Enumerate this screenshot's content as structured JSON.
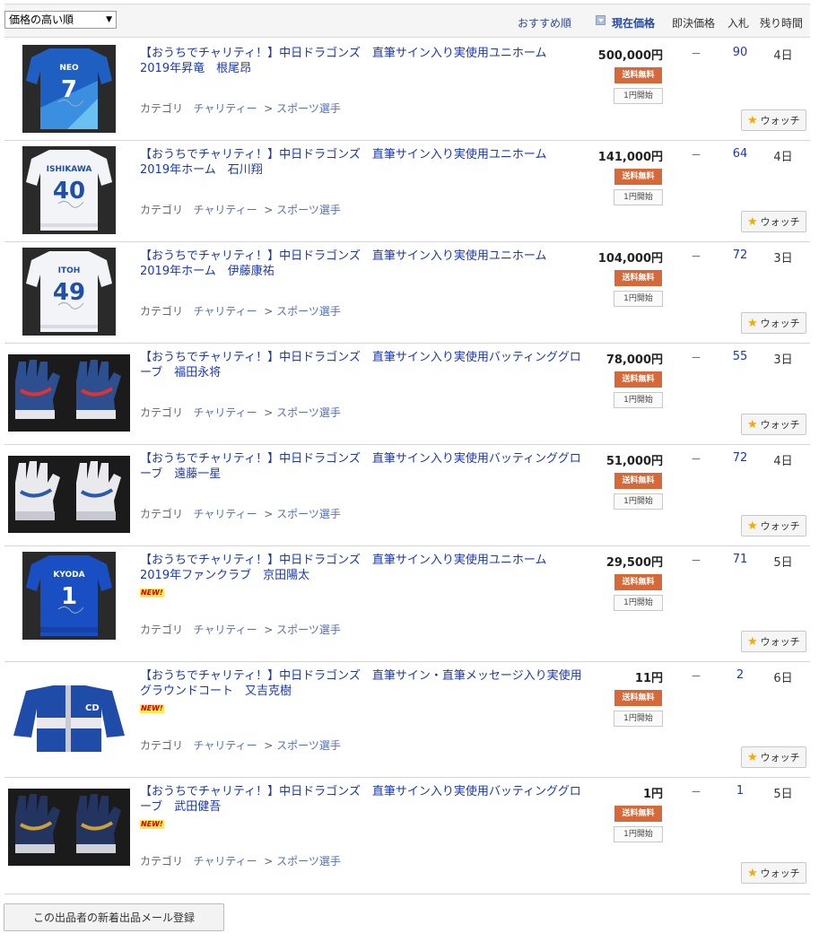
{
  "header": {
    "sort_selected": "価格の高い順",
    "recommended": "おすすめ順",
    "current_price": "現在価格",
    "buyout_price": "即決価格",
    "bids": "入札",
    "time_left": "残り時間"
  },
  "items": [
    {
      "title": "【おうちでチャリティ！】中日ドラゴンズ　直筆サイン入り実使用ユニホーム　2019年昇竜　根尾昂",
      "price": "500,000円",
      "shipping": "送料無料",
      "start": "1円開始",
      "buyout": "－",
      "bids": "90",
      "time_left": "4日",
      "category_label": "カテゴリ",
      "category1": "チャリティー",
      "category2": "スポーツ選手",
      "watch": "ウォッチ",
      "image": "jersey-blue-7",
      "new": ""
    },
    {
      "title": "【おうちでチャリティ！】中日ドラゴンズ　直筆サイン入り実使用ユニホーム　2019年ホーム　石川翔",
      "price": "141,000円",
      "shipping": "送料無料",
      "start": "1円開始",
      "buyout": "－",
      "bids": "64",
      "time_left": "4日",
      "category_label": "カテゴリ",
      "category1": "チャリティー",
      "category2": "スポーツ選手",
      "watch": "ウォッチ",
      "image": "jersey-white-40",
      "new": ""
    },
    {
      "title": "【おうちでチャリティ！】中日ドラゴンズ　直筆サイン入り実使用ユニホーム　2019年ホーム　伊藤康祐",
      "price": "104,000円",
      "shipping": "送料無料",
      "start": "1円開始",
      "buyout": "－",
      "bids": "72",
      "time_left": "3日",
      "category_label": "カテゴリ",
      "category1": "チャリティー",
      "category2": "スポーツ選手",
      "watch": "ウォッチ",
      "image": "jersey-white-49",
      "new": ""
    },
    {
      "title": "【おうちでチャリティ！】中日ドラゴンズ　直筆サイン入り実使用バッティンググローブ　福田永将",
      "price": "78,000円",
      "shipping": "送料無料",
      "start": "1円開始",
      "buyout": "－",
      "bids": "55",
      "time_left": "3日",
      "category_label": "カテゴリ",
      "category1": "チャリティー",
      "category2": "スポーツ選手",
      "watch": "ウォッチ",
      "image": "gloves-blue-red",
      "new": ""
    },
    {
      "title": "【おうちでチャリティ！】中日ドラゴンズ　直筆サイン入り実使用バッティンググローブ　遠藤一星",
      "price": "51,000円",
      "shipping": "送料無料",
      "start": "1円開始",
      "buyout": "－",
      "bids": "72",
      "time_left": "4日",
      "category_label": "カテゴリ",
      "category1": "チャリティー",
      "category2": "スポーツ選手",
      "watch": "ウォッチ",
      "image": "gloves-white",
      "new": ""
    },
    {
      "title": "【おうちでチャリティ！】中日ドラゴンズ　直筆サイン入り実使用ユニホーム　2019年ファンクラブ　京田陽太",
      "price": "29,500円",
      "shipping": "送料無料",
      "start": "1円開始",
      "buyout": "－",
      "bids": "71",
      "time_left": "5日",
      "category_label": "カテゴリ",
      "category1": "チャリティー",
      "category2": "スポーツ選手",
      "watch": "ウォッチ",
      "image": "jersey-blue-1",
      "new": "NEW!"
    },
    {
      "title": "【おうちでチャリティ！】中日ドラゴンズ　直筆サイン・直筆メッセージ入り実使用グラウンドコート　又吉克樹",
      "price": "11円",
      "shipping": "送料無料",
      "start": "1円開始",
      "buyout": "－",
      "bids": "2",
      "time_left": "6日",
      "category_label": "カテゴリ",
      "category1": "チャリティー",
      "category2": "スポーツ選手",
      "watch": "ウォッチ",
      "image": "ground-coat",
      "new": "NEW!"
    },
    {
      "title": "【おうちでチャリティ！】中日ドラゴンズ　直筆サイン入り実使用バッティンググローブ　武田健吾",
      "price": "1円",
      "shipping": "送料無料",
      "start": "1円開始",
      "buyout": "－",
      "bids": "1",
      "time_left": "5日",
      "category_label": "カテゴリ",
      "category1": "チャリティー",
      "category2": "スポーツ選手",
      "watch": "ウォッチ",
      "image": "gloves-dark",
      "new": "NEW!"
    }
  ],
  "jersey_text": {
    "neo": "NEO",
    "neo_num": "7",
    "ishikawa": "ISHIKAWA",
    "ishikawa_num": "40",
    "itoh": "ITOH",
    "itoh_num": "49",
    "kyoda": "KYODA",
    "kyoda_num": "1",
    "coat_logo": "CD"
  },
  "footer": {
    "subscribe": "この出品者の新着出品メール登録"
  }
}
